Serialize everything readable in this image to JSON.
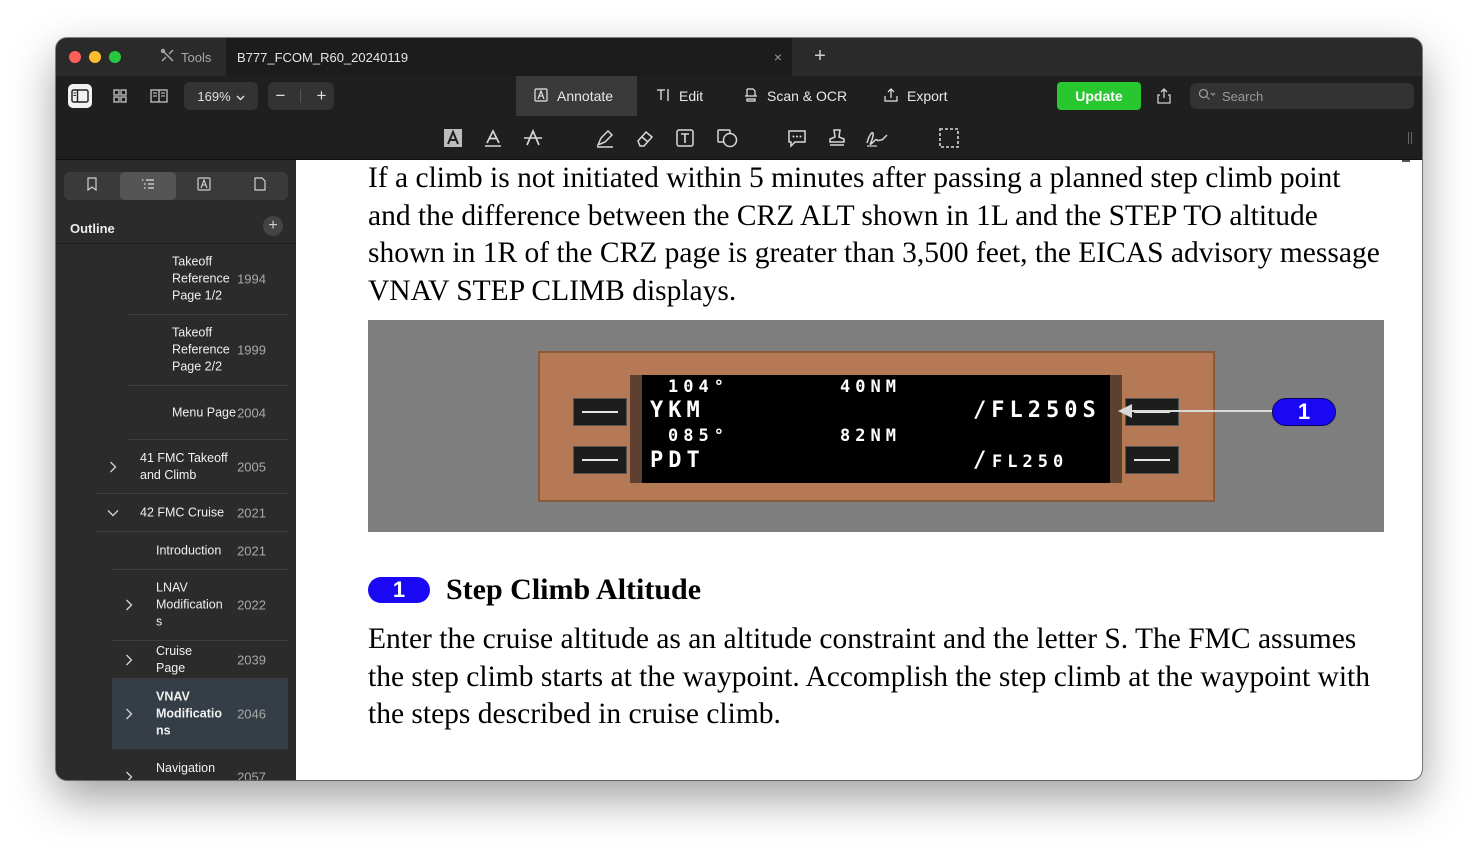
{
  "titlebar": {
    "tools_label": "Tools",
    "doc_tab_title": "B777_FCOM_R60_20240119",
    "close_glyph": "×",
    "new_tab_glyph": "+"
  },
  "toolbar": {
    "zoom_value": "169%",
    "zoom_out": "−",
    "zoom_in": "+",
    "modes": {
      "annotate": "Annotate",
      "edit": "Edit",
      "scan_ocr": "Scan & OCR",
      "export": "Export"
    },
    "update_label": "Update",
    "search_placeholder": "Search"
  },
  "sidebar": {
    "outline_title": "Outline",
    "add_glyph": "+",
    "items": [
      {
        "label": "Takeoff Reference Page 1/2",
        "page": "1994",
        "level": 2,
        "chevron": "none",
        "selected": false
      },
      {
        "label": "Takeoff Reference Page 2/2",
        "page": "1999",
        "level": 2,
        "chevron": "none",
        "selected": false
      },
      {
        "label": "Menu Page",
        "page": "2004",
        "level": 2,
        "chevron": "none",
        "selected": false
      },
      {
        "label": "41 FMC Takeoff and Climb",
        "page": "2005",
        "level": 0,
        "chevron": "right",
        "selected": false
      },
      {
        "label": "42 FMC Cruise",
        "page": "2021",
        "level": 0,
        "chevron": "down",
        "selected": false
      },
      {
        "label": "Introduction",
        "page": "2021",
        "level": 1,
        "chevron": "none",
        "selected": false
      },
      {
        "label": "LNAV Modification s",
        "page": "2022",
        "level": 1,
        "chevron": "right",
        "selected": false
      },
      {
        "label": "Cruise Page",
        "page": "2039",
        "level": 1,
        "chevron": "right",
        "selected": false
      },
      {
        "label": "VNAV Modificatio ns",
        "page": "2046",
        "level": 1,
        "chevron": "right",
        "selected": true
      },
      {
        "label": "Navigation Data",
        "page": "2057",
        "level": 1,
        "chevron": "right",
        "selected": false
      }
    ]
  },
  "document": {
    "paragraph_1": "If a climb is not initiated within 5 minutes after passing a planned step climb point and the difference between the CRZ ALT shown in 1L and the STEP TO altitude shown in 1R of the CRZ page is greater than 3,500 feet, the EICAS advisory message VNAV STEP CLIMB displays.",
    "cdu": {
      "line1_left": "104°",
      "line1_center": "40NM",
      "line2_left": "YKM",
      "line2_right": "/FL250S",
      "line3_left": "085°",
      "line3_center": "82NM",
      "line4_left": "PDT",
      "line4_right_slash": "/",
      "line4_right": "FL250"
    },
    "callout_number": "1",
    "heading_badge": "1",
    "heading_text": "Step Climb Altitude",
    "paragraph_2": "Enter the cruise altitude as an altitude constraint and the letter S. The FMC assumes the step climb starts at the waypoint. Accomplish the step climb at the waypoint with the steps described in cruise climb."
  },
  "colors": {
    "update_button": "#28c62f",
    "callout_badge": "#1a08f4",
    "cdu_bezel": "#b57a55",
    "figure_background": "#7e7e7e",
    "selected_outline_row": "#353d46"
  },
  "icons": {
    "toolbar": [
      "sidebar-toggle-icon",
      "thumbnails-icon",
      "reader-icon",
      "share-icon",
      "search-icon"
    ],
    "annotate": [
      "highlight-text-icon",
      "underline-icon",
      "strikethrough-icon",
      "pen-icon",
      "eraser-icon",
      "textbox-icon",
      "shapes-icon",
      "note-icon",
      "stamp-icon",
      "signature-icon",
      "area-select-icon"
    ],
    "sidebar_tabs": [
      "bookmark-icon",
      "outline-icon",
      "annotation-list-icon",
      "page-icon"
    ]
  }
}
